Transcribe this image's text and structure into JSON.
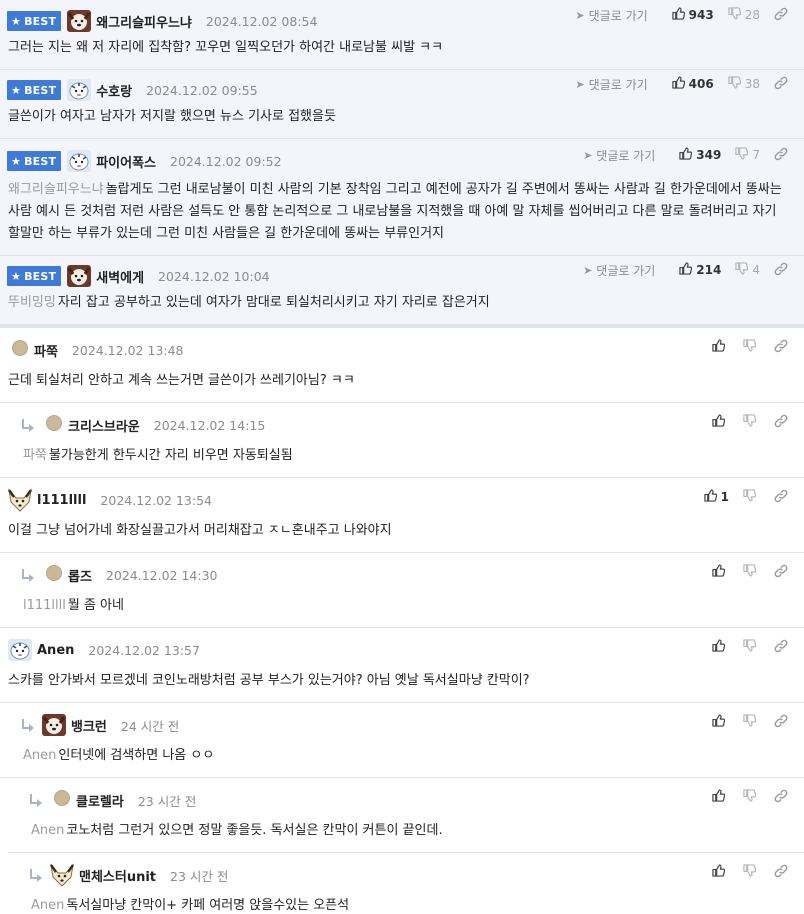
{
  "labels": {
    "best": "BEST",
    "goto_reply": "댓글로 가기"
  },
  "colors": {
    "best_bg": "#3e7ad6",
    "best_row_bg": "#f3f5fb",
    "mention": "#9b9b9b",
    "date": "#8c8c8c"
  },
  "best_comments": [
    {
      "nick": "왜그리슬피우느냐",
      "date": "2024.12.02 08:54",
      "likes": "943",
      "dislikes": "28",
      "mention": "",
      "text": "그러는 지는 왜 저 자리에 집착함? 꼬우면 일찍오던가 하여간 내로남불 씨발 ㅋㅋ",
      "avatar": "dog-avatar-icon"
    },
    {
      "nick": "수호랑",
      "date": "2024.12.02 09:55",
      "likes": "406",
      "dislikes": "38",
      "mention": "",
      "text": "글쓴이가 여자고 남자가 저지랄 했으면 뉴스 기사로 접했을듯",
      "avatar": "tiger-avatar-icon"
    },
    {
      "nick": "파이어폭스",
      "date": "2024.12.02 09:52",
      "likes": "349",
      "dislikes": "7",
      "mention": "왜그리슬피우느냐",
      "text": "놀랍게도 그런 내로남불이 미친 사람의 기본 장착임 그리고 예전에 공자가 길 주변에서 똥싸는 사람과 길 한가운데에서 똥싸는 사람 예시 든 것처럼 저런 사람은 설득도 안 통함 논리적으로 그 내로남불을 지적했을 때 아예 말 자체를 씹어버리고 다른 말로 돌려버리고 자기 할말만 하는 부류가 있는데 그런 미친 사람들은 길 한가운데에 똥싸는 부류인거지",
      "avatar": "tiger-avatar-icon"
    },
    {
      "nick": "새벽에게",
      "date": "2024.12.02 10:04",
      "likes": "214",
      "dislikes": "4",
      "mention": "뚜비밍밍",
      "text": "자리 잡고 공부하고 있는데 여자가 맘대로 퇴실처리시키고 자기 자리로 잡은거지",
      "avatar": "dog-avatar-icon"
    }
  ],
  "comments": [
    {
      "nick": "파쭉",
      "date": "2024.12.02 13:48",
      "likes": "",
      "mention": "",
      "text": "근데 퇴실처리 안하고 계속 쓰는거면 글쓴이가 쓰레기아님? ㅋㅋ",
      "reply": false,
      "avatar": "dot"
    },
    {
      "nick": "크리스브라운",
      "date": "2024.12.02 14:15",
      "likes": "",
      "mention": "파쭉",
      "text": "불가능한게 한두시간 자리 비우면 자동퇴실됨",
      "reply": true,
      "avatar": "dot"
    },
    {
      "nick": "l111llll",
      "date": "2024.12.02 13:54",
      "likes": "1",
      "mention": "",
      "text": "이걸 그냥 넘어가네 화장실끌고가서 머리채잡고 ㅈㄴ혼내주고 나와야지",
      "reply": false,
      "avatar": "fox"
    },
    {
      "nick": "롭즈",
      "date": "2024.12.02 14:30",
      "likes": "",
      "mention": "l111llll",
      "text": "뭘 좀 아네",
      "reply": true,
      "avatar": "dot"
    },
    {
      "nick": "Anen",
      "date": "2024.12.02 13:57",
      "likes": "",
      "mention": "",
      "text": "스카를 안가봐서 모르겠네 코인노래방처럼 공부 부스가 있는거야? 아님 옛날 독서실마냥 칸막이?",
      "reply": false,
      "avatar": "tiger"
    },
    {
      "nick": "뱅크런",
      "date": "24 시간 전",
      "likes": "",
      "mention": "Anen",
      "text": "인터넷에 검색하면 나옴 ㅇㅇ",
      "reply": true,
      "avatar": "dog"
    },
    {
      "nick": "클로렐라",
      "date": "23 시간 전",
      "likes": "",
      "mention": "Anen",
      "text": "코노처럼 그런거 있으면 정말 좋을듯. 독서실은 칸막이 커튼이 끝인데.",
      "reply": true,
      "avatar": "dot"
    },
    {
      "nick": "맨체스터unit",
      "date": "23 시간 전",
      "likes": "",
      "mention": "Anen",
      "text": "독서실마냥 칸막이+ 카페 여러명 앉을수있는 오픈석",
      "reply": true,
      "avatar": "fox"
    }
  ]
}
